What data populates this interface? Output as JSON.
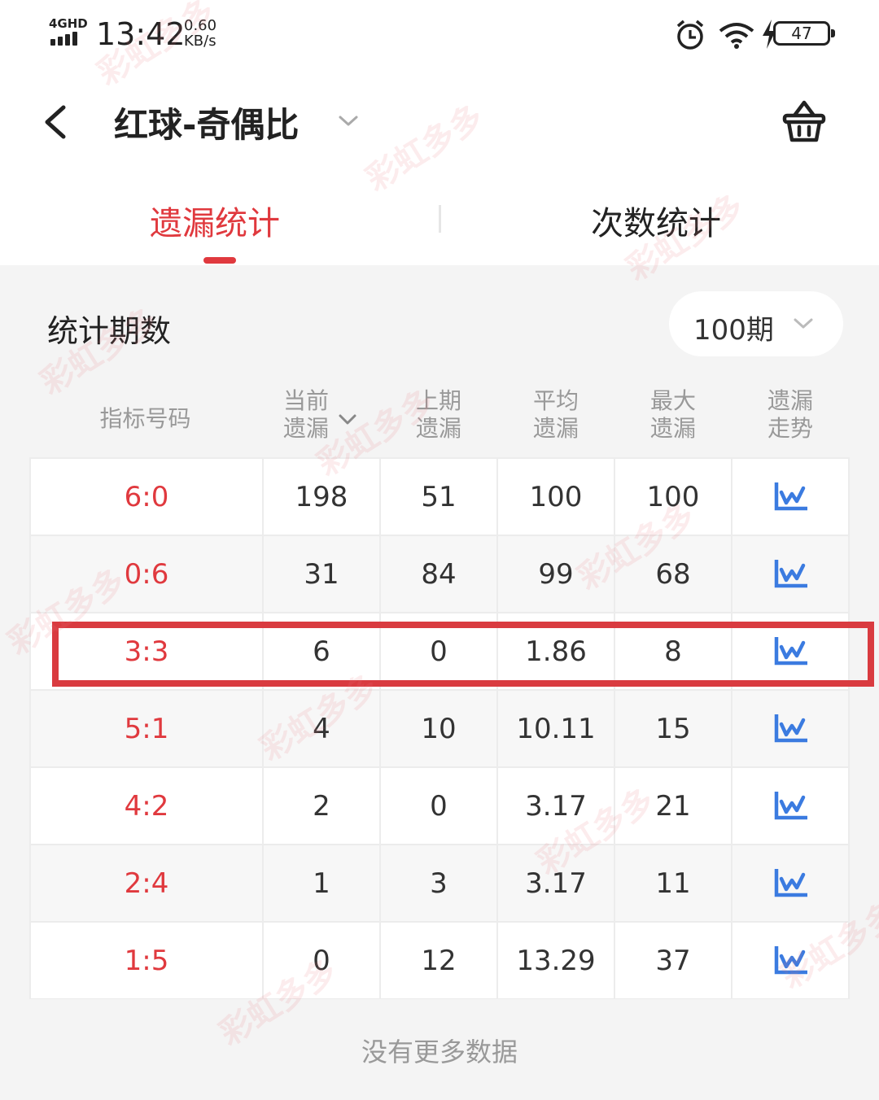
{
  "status_bar": {
    "network": "4GHD",
    "time": "13:42",
    "speed_value": "0.60",
    "speed_unit": "KB/s",
    "battery": "47"
  },
  "header": {
    "title": "红球-奇偶比"
  },
  "tabs": [
    {
      "label": "遗漏统计",
      "active": true
    },
    {
      "label": "次数统计",
      "active": false
    }
  ],
  "period": {
    "label": "统计期数",
    "value": "100期"
  },
  "table": {
    "columns": [
      "指标号码",
      "当前遗漏",
      "上期遗漏",
      "平均遗漏",
      "最大遗漏",
      "遗漏走势"
    ],
    "rows": [
      {
        "code": "6:0",
        "current": "198",
        "last": "51",
        "avg": "100",
        "max": "100"
      },
      {
        "code": "0:6",
        "current": "31",
        "last": "84",
        "avg": "99",
        "max": "68"
      },
      {
        "code": "3:3",
        "current": "6",
        "last": "0",
        "avg": "1.86",
        "max": "8"
      },
      {
        "code": "5:1",
        "current": "4",
        "last": "10",
        "avg": "10.11",
        "max": "15"
      },
      {
        "code": "4:2",
        "current": "2",
        "last": "0",
        "avg": "3.17",
        "max": "21"
      },
      {
        "code": "2:4",
        "current": "1",
        "last": "3",
        "avg": "3.17",
        "max": "11"
      },
      {
        "code": "1:5",
        "current": "0",
        "last": "12",
        "avg": "13.29",
        "max": "37"
      }
    ],
    "highlighted_row": 2
  },
  "footer": "没有更多数据",
  "watermark": "彩虹多多",
  "colors": {
    "accent": "#e0393e",
    "trend_icon": "#3b7be0",
    "highlight_border": "#d93b40"
  },
  "icons": [
    "back-arrow-icon",
    "chevron-down-icon",
    "basket-icon",
    "trend-chart-icon",
    "alarm-icon",
    "wifi-icon",
    "charging-icon"
  ]
}
